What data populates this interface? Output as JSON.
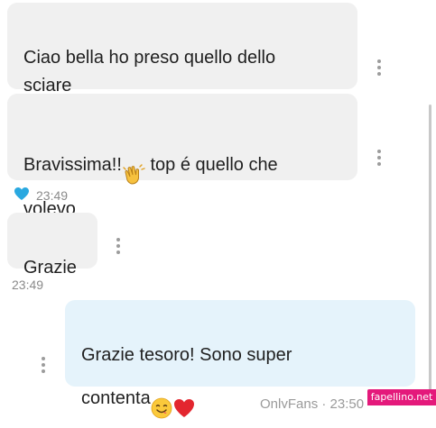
{
  "messages": [
    {
      "text": "Ciao bella ho preso quello dello\nsciare"
    },
    {
      "text": "Bravissima!!",
      "text_after_emoji": " top é quello che\nvolevo",
      "emoji": "clapping-hands"
    },
    {
      "time": "23:49",
      "reaction": "heart-icon"
    },
    {
      "text": "Grazie"
    },
    {
      "time": "23:49"
    },
    {
      "text": "Grazie tesoro! Sono super\ncontenta",
      "emojis": [
        "smiling-face-icon",
        "red-heart-icon"
      ]
    }
  ],
  "footer_text": "OnlyFans · 23:50",
  "watermark": "fapellino.net",
  "colors": {
    "incoming_bubble": "#f0f0f0",
    "outgoing_bubble": "#e5f3fb",
    "reaction_heart": "#29a8e0",
    "watermark_bg": "#e4197b"
  }
}
